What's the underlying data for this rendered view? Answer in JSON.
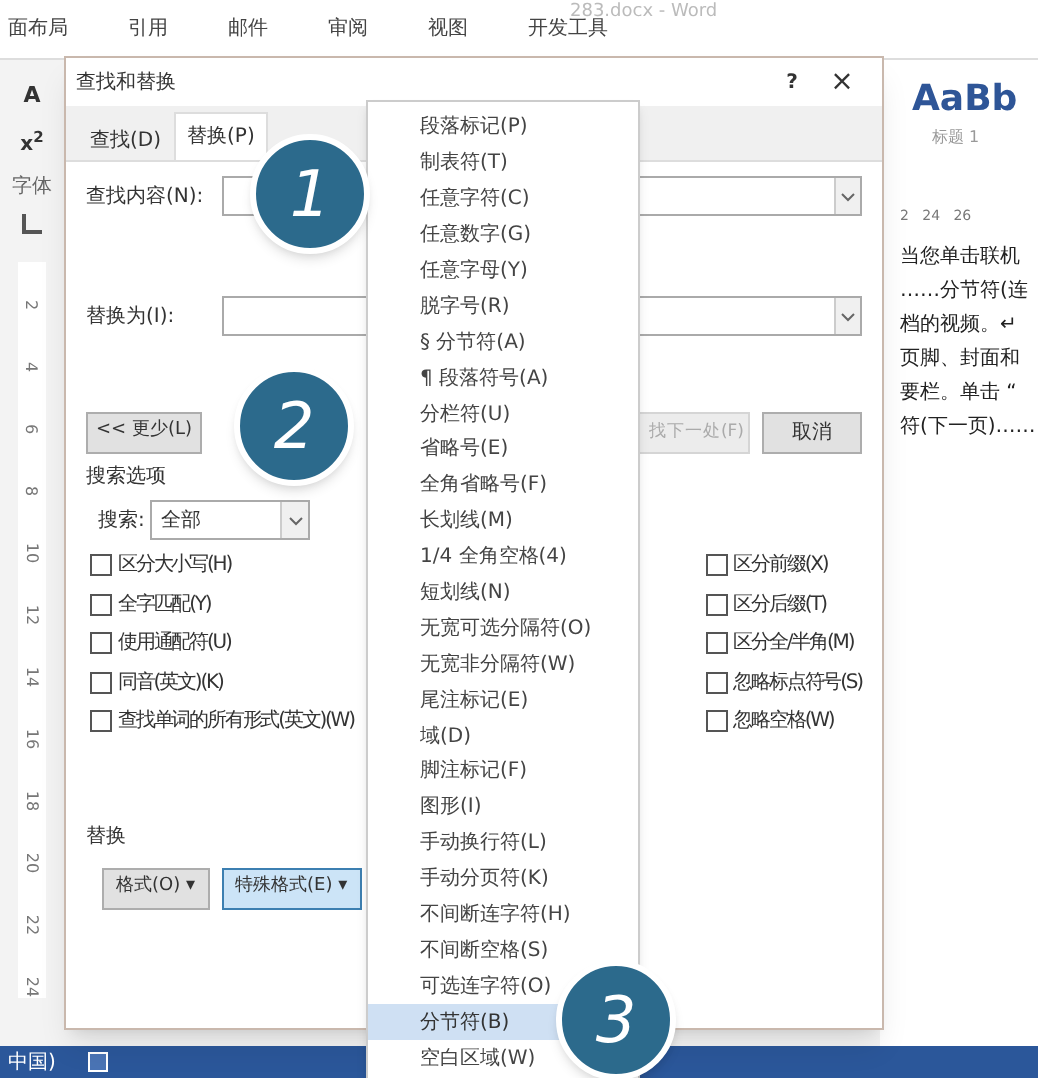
{
  "word": {
    "title": "283.docx - Word",
    "ribbon_tabs": [
      "面布局",
      "引用",
      "邮件",
      "审阅",
      "视图",
      "开发工具"
    ],
    "left_tools": [
      "A",
      "x$^{2}$",
      "字体"
    ],
    "ruler_marks": [
      "2",
      "4",
      "6",
      "8",
      "10",
      "12",
      "14",
      "16",
      "18",
      "20",
      "22",
      "24"
    ],
    "style_preview": "AaBb",
    "style_name": "标题 1",
    "top_ruler": "2   24   26",
    "doc_lines": [
      "当您单击联机",
      "……分节符(连",
      "档的视频。↵",
      "页脚、封面和",
      "要栏。单击 “",
      "符(下一页)……"
    ],
    "status_bar": {
      "language": "中国)"
    }
  },
  "dialog": {
    "title": "查找和替换",
    "help": "?",
    "close": "×",
    "tabs": [
      {
        "label": "查找(D)",
        "selected": false
      },
      {
        "label": "替换(P)",
        "selected": true
      }
    ],
    "find_label": "查找内容(N):",
    "replace_label": "替换为(I):",
    "less_button": "<< 更少(L)",
    "find_next_button": {
      "label": "找下一处(F)",
      "disabled": true
    },
    "cancel_button": "取消",
    "search_options_title": "搜索选项",
    "search_label": "搜索:",
    "search_value": "全部",
    "options_left": [
      {
        "label": "区分大小写(H)",
        "checked": false
      },
      {
        "label": "全字匹配(Y)",
        "checked": false
      },
      {
        "label": "使用通配符(U)",
        "checked": false
      },
      {
        "label": "同音(英文)(K)",
        "checked": false
      },
      {
        "label": "查找单词的所有形式(英文)(W)",
        "checked": false
      }
    ],
    "options_right": [
      {
        "label": "区分前缀(X)",
        "checked": false
      },
      {
        "label": "区分后缀(T)",
        "checked": false
      },
      {
        "label": "区分全/半角(M)",
        "checked": false
      },
      {
        "label": "忽略标点符号(S)",
        "checked": false
      },
      {
        "label": "忽略空格(W)",
        "checked": false
      }
    ],
    "replace_section_title": "替换",
    "format_button": {
      "label": "格式(O) ▾",
      "selected": false
    },
    "special_button": {
      "label": "特殊格式(E) ▾",
      "selected": true
    }
  },
  "special_menu": [
    {
      "label": "段落标记(P)",
      "selected": false
    },
    {
      "label": "制表符(T)",
      "selected": false
    },
    {
      "label": "任意字符(C)",
      "selected": false
    },
    {
      "label": "任意数字(G)",
      "selected": false
    },
    {
      "label": "任意字母(Y)",
      "selected": false
    },
    {
      "label": "脱字号(R)",
      "selected": false
    },
    {
      "label": "§ 分节符(A)",
      "selected": false
    },
    {
      "label": "¶ 段落符号(A)",
      "selected": false
    },
    {
      "label": "分栏符(U)",
      "selected": false
    },
    {
      "label": "省略号(E)",
      "selected": false
    },
    {
      "label": "全角省略号(F)",
      "selected": false
    },
    {
      "label": "长划线(M)",
      "selected": false
    },
    {
      "label": "1/4 全角空格(4)",
      "selected": false
    },
    {
      "label": "短划线(N)",
      "selected": false
    },
    {
      "label": "无宽可选分隔符(O)",
      "selected": false
    },
    {
      "label": "无宽非分隔符(W)",
      "selected": false
    },
    {
      "label": "尾注标记(E)",
      "selected": false
    },
    {
      "label": "域(D)",
      "selected": false
    },
    {
      "label": "脚注标记(F)",
      "selected": false
    },
    {
      "label": "图形(I)",
      "selected": false
    },
    {
      "label": "手动换行符(L)",
      "selected": false
    },
    {
      "label": "手动分页符(K)",
      "selected": false
    },
    {
      "label": "不间断连字符(H)",
      "selected": false
    },
    {
      "label": "不间断空格(S)",
      "selected": false
    },
    {
      "label": "可选连字符(O)",
      "selected": false
    },
    {
      "label": "分节符(B)",
      "selected": true
    },
    {
      "label": "空白区域(W)",
      "selected": false
    }
  ],
  "callouts": [
    "1",
    "2",
    "3"
  ]
}
